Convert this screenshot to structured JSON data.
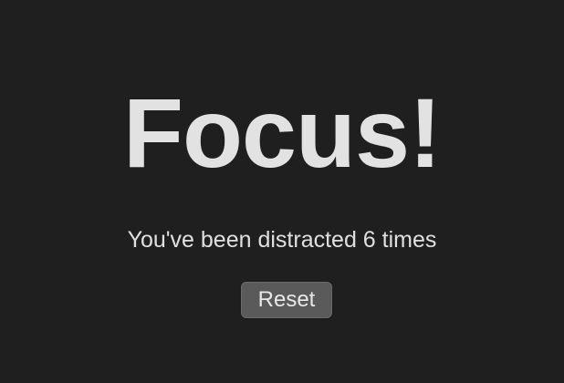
{
  "colors": {
    "background": "#1f1f1f",
    "text": "#e2e2e2",
    "button_background": "#5a5a5a",
    "button_text": "#e8e8e8"
  },
  "focus": {
    "title": "Focus!",
    "message": "You've been distracted 6 times",
    "distraction_count": 6,
    "reset_label": "Reset"
  }
}
